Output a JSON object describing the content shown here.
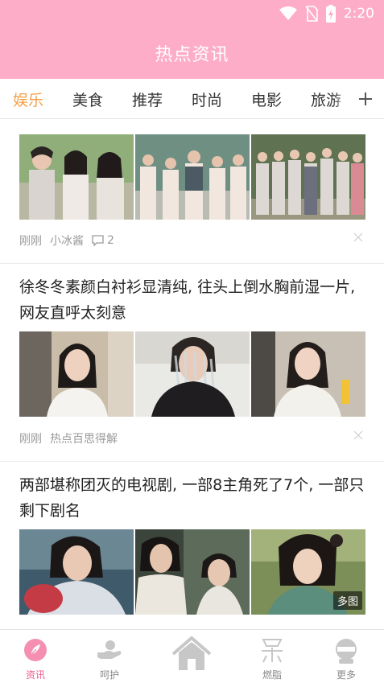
{
  "status_bar": {
    "time": "2:20",
    "icons": [
      "wifi-icon",
      "no-sim-icon",
      "battery-charging-icon"
    ]
  },
  "header": {
    "title": "热点资讯"
  },
  "tabs": {
    "items": [
      "娱乐",
      "美食",
      "推荐",
      "时尚",
      "电影",
      "旅游"
    ],
    "active": "娱乐",
    "add_icon": "plus-icon"
  },
  "feed": {
    "items": [
      {
        "title": "",
        "time": "刚刚",
        "source": "小冰酱",
        "comments": "2",
        "images": [
          "group-photo-costume-1",
          "group-photo-costume-2",
          "group-photo-costume-3"
        ]
      },
      {
        "title": "徐冬冬素颜白衬衫显清纯, 往头上倒水胸前湿一片, 网友直呼太刻意",
        "time": "刚刚",
        "source": "热点百思得解",
        "images": [
          "portrait-white-shirt",
          "water-pour-photo",
          "wet-white-shirt"
        ]
      },
      {
        "title": "两部堪称团灭的电视剧, 一部8主角死了7个, 一部只剩下剧名",
        "images": [
          "drama-still-1",
          "drama-still-2",
          "drama-still-3"
        ],
        "badge": "多图"
      }
    ]
  },
  "bottom_nav": {
    "items": [
      {
        "label": "资讯",
        "icon": "feather-icon",
        "active": true
      },
      {
        "label": "呵护",
        "icon": "care-hand-icon",
        "active": false
      },
      {
        "label": "",
        "icon": "home-icon",
        "active": false
      },
      {
        "label": "燃脂",
        "icon": "fat-burn-icon",
        "active": false
      },
      {
        "label": "更多",
        "icon": "more-icon",
        "active": false
      }
    ]
  },
  "colors": {
    "brand_pink": "#fdadc8",
    "active_tab": "#f5a04a",
    "active_nav": "#f25b8c"
  }
}
